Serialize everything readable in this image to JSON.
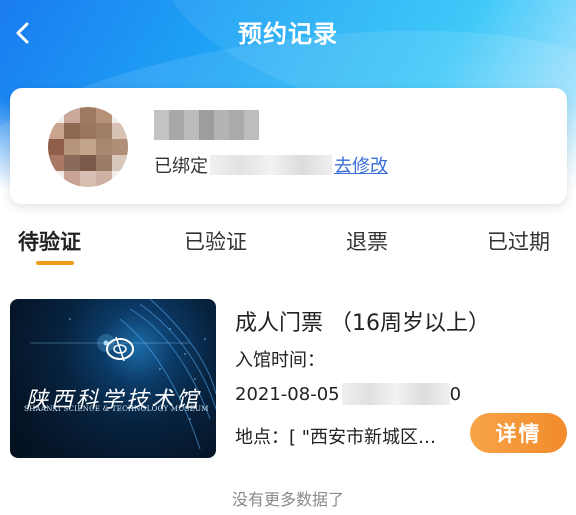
{
  "header": {
    "title": "预约记录",
    "back_icon": "chevron-left-icon",
    "gradient": [
      "#1a7cf0",
      "#2ec4f8"
    ]
  },
  "profile": {
    "bound_prefix": "已绑定",
    "change_link": "去修改",
    "link_color": "#3a6fd8"
  },
  "tabs": [
    {
      "label": "待验证",
      "active": true
    },
    {
      "label": "已验证",
      "active": false
    },
    {
      "label": "退票",
      "active": false
    },
    {
      "label": "已过期",
      "active": false
    }
  ],
  "accent_color": "#f29c1f",
  "ticket": {
    "image": {
      "cn_title": "陕西科学技术馆",
      "en_title": "SHAANXI SCIENCE & TECHNOLOGY MUSEUM"
    },
    "title": "成人门票  （16周岁以上）",
    "entry_label": "入馆时间：",
    "entry_date": "2021-08-05",
    "entry_time_tail": "0",
    "address_label": "地点：",
    "address_value": "[ \"西安市新城区…",
    "detail_button": "详情",
    "button_color": "#f28b2c"
  },
  "footer": {
    "no_more": "没有更多数据了"
  }
}
